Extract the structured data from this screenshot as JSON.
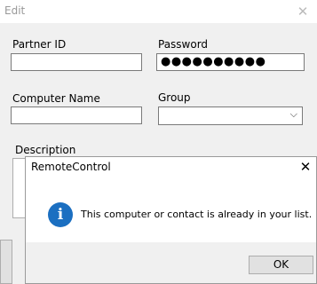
{
  "edit_window": {
    "title": "Edit",
    "close_glyph": "✕",
    "partner_id": {
      "label": "Partner ID",
      "value": ""
    },
    "password": {
      "label": "Password",
      "value": "●●●●●●●●●●"
    },
    "computer_name": {
      "label": "Computer Name",
      "value": ""
    },
    "group": {
      "label": "Group",
      "selected": ""
    },
    "description": {
      "label": "Description",
      "value": ""
    }
  },
  "dialog": {
    "title": "RemoteControl",
    "close_glyph": "✕",
    "icon": "info-icon",
    "icon_glyph": "i",
    "message": "This computer or contact is already in your list.",
    "ok_label": "OK",
    "icon_color": "#1b6fc1"
  }
}
